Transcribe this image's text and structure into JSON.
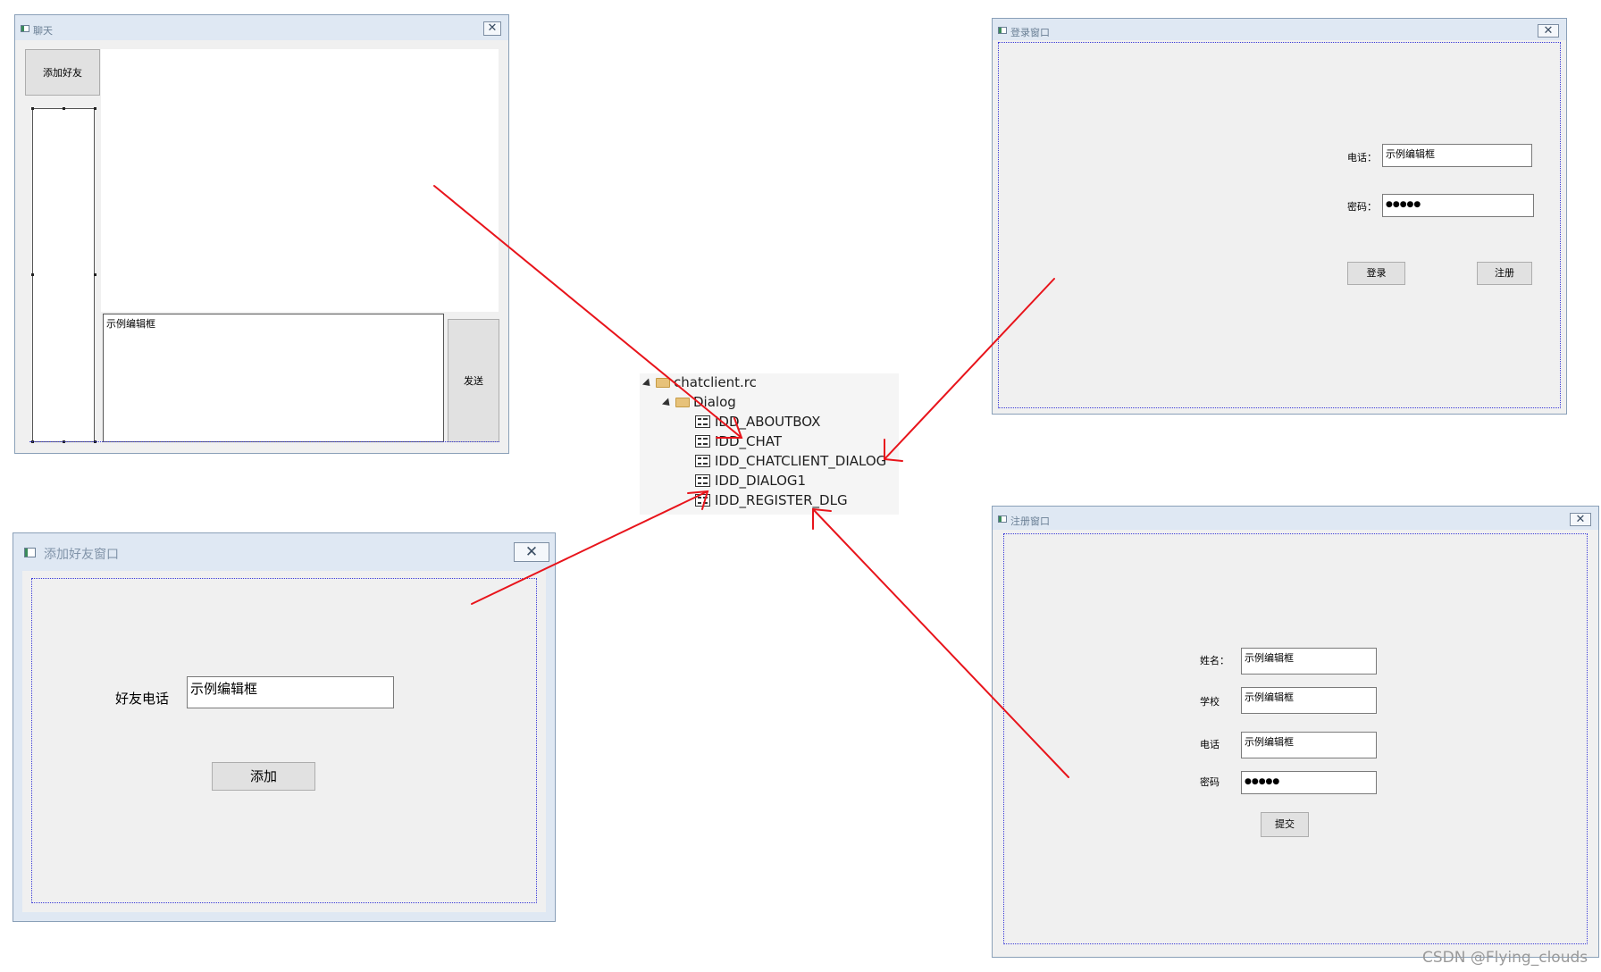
{
  "chat_window": {
    "title": "聊天",
    "close_glyph": "✕",
    "add_friend_button": "添加好友",
    "input_placeholder_text": "示例编辑框",
    "send_button": "发送"
  },
  "login_window": {
    "title": "登录窗口",
    "close_glyph": "✕",
    "phone_label": "电话：",
    "phone_value": "示例编辑框",
    "password_label": "密码：",
    "password_value": "●●●●●",
    "login_button": "登录",
    "register_button": "注册"
  },
  "add_friend_window": {
    "title": "添加好友窗口",
    "close_glyph": "✕",
    "phone_label": "好友电话",
    "phone_value": "示例编辑框",
    "add_button": "添加"
  },
  "register_window": {
    "title": "注册窗口",
    "close_glyph": "✕",
    "name_label": "姓名：",
    "name_value": "示例编辑框",
    "school_label": "学校",
    "school_value": "示例编辑框",
    "phone_label": "电话",
    "phone_value": "示例编辑框",
    "password_label": "密码",
    "password_value": "●●●●●",
    "submit_button": "提交"
  },
  "resource_tree": {
    "root": "chatclient.rc",
    "folder": "Dialog",
    "items": [
      "IDD_ABOUTBOX",
      "IDD_CHAT",
      "IDD_CHATCLIENT_DIALOG",
      "IDD_DIALOG1",
      "IDD_REGISTER_DLG"
    ]
  },
  "annotation_color": "#e8141b",
  "watermark": "CSDN @Flying_clouds"
}
